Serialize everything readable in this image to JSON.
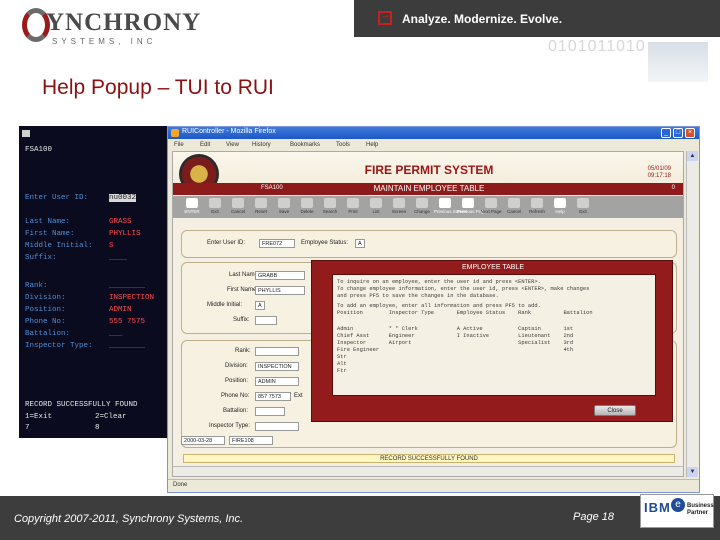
{
  "brand": {
    "name": "YNCHRONY",
    "tagline_small": "SYSTEMS, INC",
    "tagline": "Analyze. Modernize. Evolve.",
    "binary": "0101011010"
  },
  "slide": {
    "title": "Help Popup – TUI to RUI",
    "copyright": "Copyright 2007-2011, Synchrony Systems, Inc.",
    "page": "Page 18"
  },
  "ibm": {
    "logo": "IBM",
    "badge": "e",
    "partner": "Business Partner"
  },
  "tui": {
    "code": "FSA100",
    "rows": [
      {
        "label": "Enter User ID:",
        "value": "nu0032",
        "highlight": true
      },
      {
        "label": "Last Name:",
        "value": "GRASS"
      },
      {
        "label": "First Name:",
        "value": "PHYLLIS"
      },
      {
        "label": "Middle Initial:",
        "value": "S"
      },
      {
        "label": "Suffix:",
        "value": "____"
      },
      {
        "label": "Rank:",
        "value": "________"
      },
      {
        "label": "Division:",
        "value": "INSPECTION"
      },
      {
        "label": "Position:",
        "value": "ADMIN"
      },
      {
        "label": "Phone No:",
        "value": "555 7575"
      },
      {
        "label": "Battalion:",
        "value": "___"
      },
      {
        "label": "Inspector Type:",
        "value": "________"
      }
    ],
    "message": "RECORD SUCCESSFULLY FOUND",
    "footer": [
      {
        "a": "1=Exit",
        "b": "2=Clear"
      },
      {
        "a": "7",
        "b": "8"
      }
    ]
  },
  "browser": {
    "title": "RUIController - Mozilla Firefox",
    "menu": [
      "File",
      "Edit",
      "View",
      "History",
      "Bookmarks",
      "Tools",
      "Help"
    ],
    "status": "Done"
  },
  "app": {
    "title": "FIRE PERMIT SYSTEM",
    "date": "05/01/09",
    "time": "09:17:18",
    "screen_code": "FSA100",
    "subtitle": "MAINTAIN EMPLOYEE TABLE",
    "count": "0",
    "toolbar": [
      {
        "label": "ENTER",
        "active": true
      },
      {
        "label": "Exit",
        "active": false
      },
      {
        "label": "Cancel",
        "active": false
      },
      {
        "label": "Reset",
        "active": false
      },
      {
        "label": "Save",
        "active": false
      },
      {
        "label": "Delete",
        "active": false
      },
      {
        "label": "Search",
        "active": false
      },
      {
        "label": "Print",
        "active": false
      },
      {
        "label": "List",
        "active": false
      },
      {
        "label": "Screen",
        "active": false
      },
      {
        "label": "Change",
        "active": false
      },
      {
        "label": "Previous Screen",
        "active": true
      },
      {
        "label": "Previous Page",
        "active": true
      },
      {
        "label": "Next Page",
        "active": false
      },
      {
        "label": "Cancel",
        "active": false
      },
      {
        "label": "Refresh",
        "active": false
      },
      {
        "label": "Help",
        "active": true
      },
      {
        "label": "Exit",
        "active": false
      }
    ],
    "fields": {
      "user_id_label": "Enter User ID:",
      "user_id": "FRE072",
      "status_label": "Employee Status:",
      "status": "A",
      "last_name_label": "Last Name:",
      "last_name": "GRABB",
      "first_name_label": "First Name:",
      "first_name": "PHYLLIS",
      "middle_label": "Middle Initial:",
      "middle": "A",
      "suffix_label": "Suffix:",
      "suffix": "",
      "rank_label": "Rank:",
      "rank": "",
      "division_label": "Division:",
      "division": "INSPECTION",
      "position_label": "Position:",
      "position": "ADMIN",
      "phone_label": "Phone No:",
      "phone": "857 7573",
      "phone_ext": "Ext",
      "battalion_label": "Battalion:",
      "battalion": "",
      "inspector_label": "Inspector Type:",
      "inspector": "",
      "footer_date": "2000-03-28",
      "footer_code": "FIRE108"
    },
    "message": "RECORD SUCCESSFULLY FOUND"
  },
  "popup": {
    "title": "EMPLOYEE TABLE",
    "lines": [
      "To inquire on an employee, enter the user id and press <ENTER>.",
      "To change employee information, enter the user id, press <ENTER>, make changes",
      "and press PF5 to save the changes in the database.",
      "To add an employee, enter all information and press PF5 to add.",
      "Position        Inspector Type       Employee Status    Rank          Battalion",
      "",
      "Admin           * * Clerk            A Active           Captain       1st",
      "Chief Asst      Engineer             I Inactive         Lieutenant    2nd",
      "Inspector       Airport                                 Specialist    3rd",
      "Fire Engineer                                                         4th",
      "Str",
      "Alt",
      "Ftr"
    ],
    "close": "Close"
  }
}
